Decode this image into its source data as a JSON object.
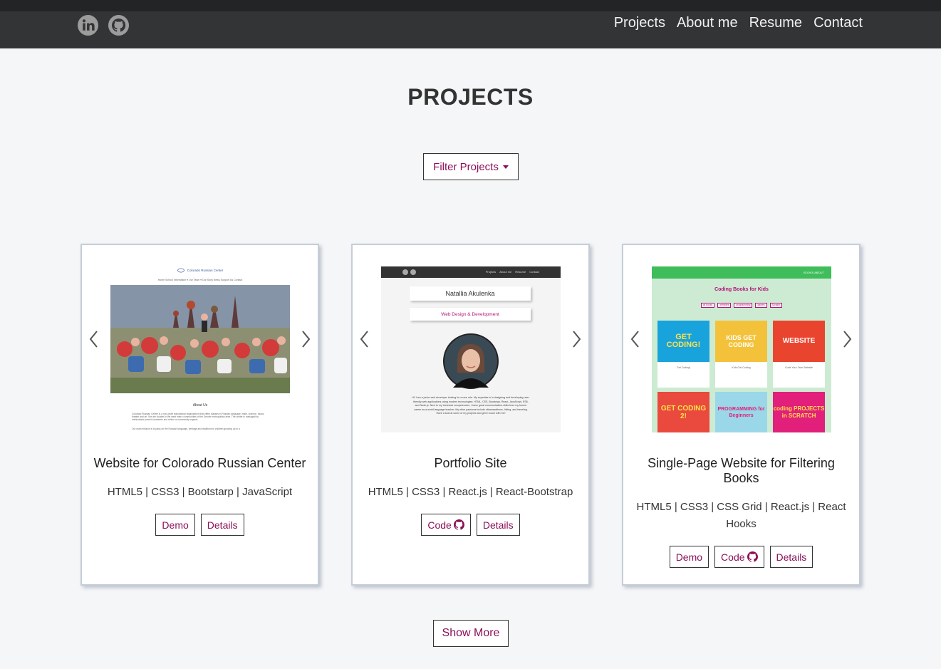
{
  "nav": {
    "social": [
      {
        "icon": "linkedin-icon"
      },
      {
        "icon": "github-icon"
      }
    ],
    "links": [
      "Projects",
      "About me",
      "Resume",
      "Contact"
    ]
  },
  "page": {
    "title": "PROJECTS",
    "filter_label": "Filter Projects",
    "show_more_label": "Show More"
  },
  "projects": [
    {
      "title": "Website for Colorado Russian Center",
      "tech": "HTML5 | CSS3 | Bootstarp | JavaScript",
      "buttons": [
        "Demo",
        "Details"
      ],
      "shot": {
        "header": "Colorado Russian Center",
        "menu": "Home   School Information ▾   Our Team ▾   Our Story   News   Support Us   Contact",
        "about": "About Us",
        "para1": "Colorado Russian Center is a non-profit educational organization that offers classes in Russian language, math, science, music, theater and art. We are located in the west metro communities of the Denver metropolitan area. The center is managed by enthusiastic parent volunteers and relies on community support.",
        "para2": "Our main mission is to pass on the Russian language, heritage and traditions to children growing up in a"
      }
    },
    {
      "title": "Portfolio Site",
      "tech": "HTML5 | CSS3 | React.js | React-Bootstrap",
      "buttons": [
        "Code",
        "Details"
      ],
      "shot": {
        "nav": [
          "Projects",
          "About me",
          "Resume",
          "Contact"
        ],
        "name": "Natallia Akulenka",
        "role": "Web Design & Development",
        "bio": "Hi! I am a junior web developer looking for a new role. My expertise is in designing and developing user-friendly web applications using modern technologies: HTML, CSS, Bootstrap, React, JavaScript, ES6, and Node.js. Next to my technical competencies, I have great communication skills from my former career as a world language teacher. My other passions include ultramarathons, hiking, and traveling. Have a look at some of my projects and get in touch with me!"
      }
    },
    {
      "title": "Single-Page Website for Filtering Books",
      "tech": "HTML5 | CSS3 | CSS Grid | React.js | React Hooks",
      "buttons": [
        "Demo",
        "Code",
        "Details"
      ],
      "shot": {
        "nav": "BOOKS   ABOUT",
        "heading": "Coding Books for Kids",
        "filters": [
          "all books",
          "websites",
          "programming",
          "games",
          "Scratch"
        ],
        "covers": [
          {
            "title": "GET CODING!",
            "caption": "Get Coding!",
            "color": "#19a3dc"
          },
          {
            "title": "KIDS GET CODING",
            "caption": "Kids Get Coding",
            "color": "#f3c23a"
          },
          {
            "title": "WEBSITE",
            "caption": "Code Your Own Website",
            "color": "#e9452e"
          },
          {
            "title": "GET CODING 2!",
            "caption": "",
            "color": "#e94a3d"
          },
          {
            "title": "PROGRAMMING for Beginners",
            "caption": "",
            "color": "#9ad7e8"
          },
          {
            "title": "coding PROJECTS in SCRATCH",
            "caption": "",
            "color": "#e21f7a"
          }
        ]
      }
    }
  ],
  "colors": {
    "accent": "#8b0e57",
    "navbar": "#333435",
    "background": "#f5f6f8",
    "books_green": "#3fbd5b"
  }
}
